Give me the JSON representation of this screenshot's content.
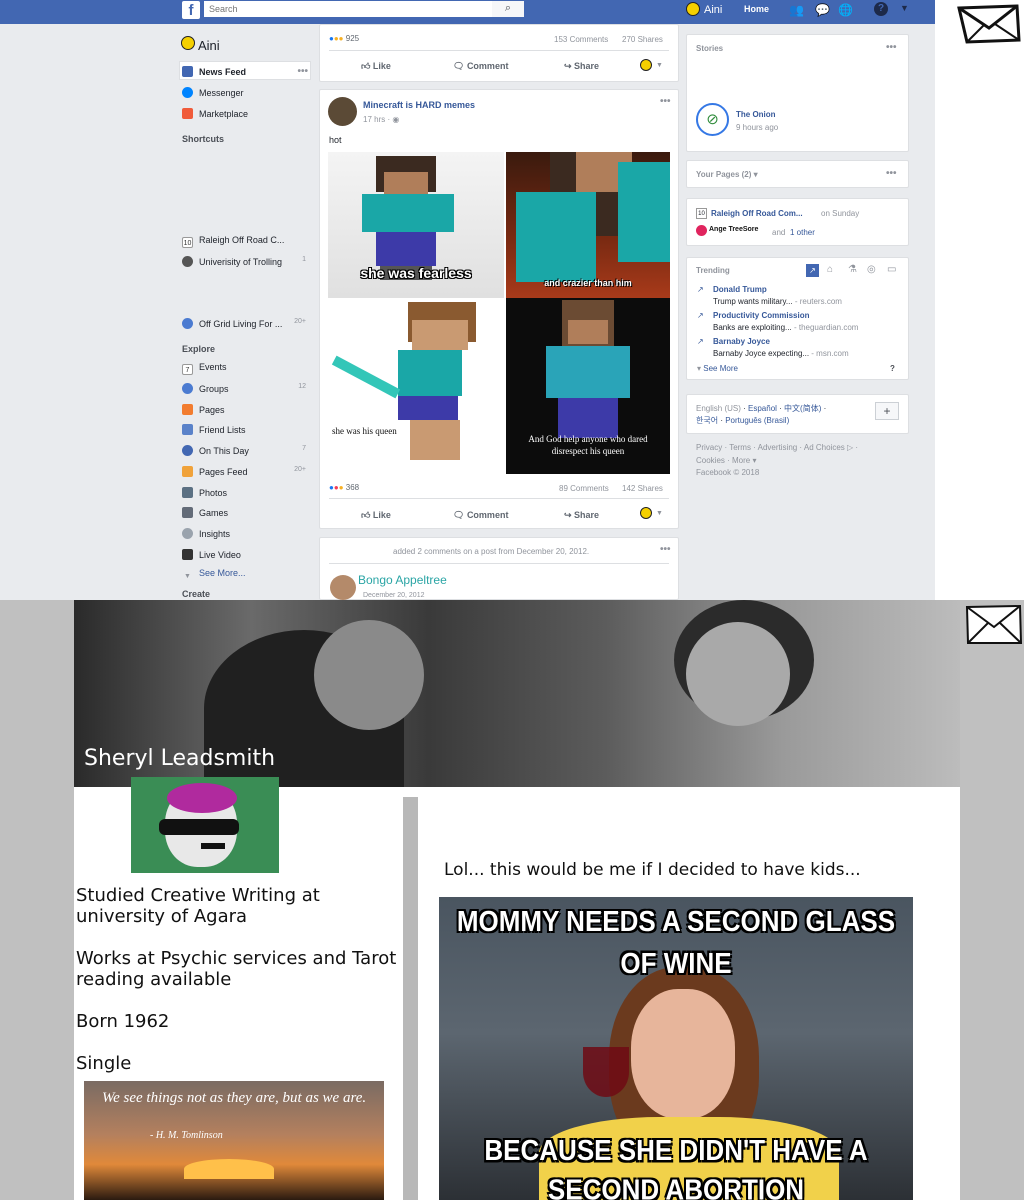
{
  "topbar": {
    "search_placeholder": "Search",
    "user": "Aini",
    "home": "Home"
  },
  "left_nav": {
    "user": "Aini",
    "items": [
      {
        "label": "News Feed",
        "icon": "news-feed-icon"
      },
      {
        "label": "Messenger",
        "icon": "messenger-icon"
      },
      {
        "label": "Marketplace",
        "icon": "marketplace-icon"
      }
    ],
    "shortcuts_heading": "Shortcuts",
    "shortcuts": [
      {
        "label": "Raleigh Off Road C...",
        "count": ""
      },
      {
        "label": "Univerisity of Trolling",
        "count": "1"
      },
      {
        "label": "Off Grid Living For ...",
        "count": "20+"
      }
    ],
    "explore_heading": "Explore",
    "explore": [
      {
        "label": "Events",
        "count": ""
      },
      {
        "label": "Groups",
        "count": "12"
      },
      {
        "label": "Pages",
        "count": ""
      },
      {
        "label": "Friend Lists",
        "count": ""
      },
      {
        "label": "On This Day",
        "count": "7"
      },
      {
        "label": "Pages Feed",
        "count": "20+"
      },
      {
        "label": "Photos",
        "count": ""
      },
      {
        "label": "Games",
        "count": ""
      },
      {
        "label": "Insights",
        "count": ""
      },
      {
        "label": "Live Video",
        "count": ""
      }
    ],
    "see_more": "See More...",
    "create_heading": "Create"
  },
  "post1": {
    "reactions": "925",
    "comments": "153 Comments",
    "shares": "270 Shares",
    "like": "Like",
    "comment": "Comment",
    "share": "Share"
  },
  "post2": {
    "author": "Minecraft is HARD memes",
    "time": "17 hrs",
    "text": "hot",
    "captions": [
      "she was fearless",
      "and crazier than him",
      "she was his queen",
      "And God help anyone who dared disrespect his queen"
    ],
    "reactions": "368",
    "comments": "89 Comments",
    "shares": "142 Shares",
    "like": "Like",
    "comment": "Comment",
    "share": "Share"
  },
  "post3": {
    "activity": "added 2 comments on a post from December 20, 2012.",
    "author": "Bongo Appeltree",
    "date": "December 20, 2012"
  },
  "right": {
    "stories_heading": "Stories",
    "story_name": "The Onion",
    "story_time": "9 hours ago",
    "your_pages": "Your Pages (2)",
    "page_name": "Raleigh Off Road Com...",
    "page_when": "on Sunday",
    "page_person": "Ange TreeSore",
    "page_and": "and",
    "page_other": "1 other",
    "trending_heading": "Trending",
    "trending": [
      {
        "title": "Donald Trump",
        "desc": "Trump wants military...",
        "source": "- reuters.com"
      },
      {
        "title": "Productivity Commission",
        "desc": "Banks are exploiting...",
        "source": "- theguardian.com"
      },
      {
        "title": "Barnaby Joyce",
        "desc": "Barnaby Joyce expecting...",
        "source": "- msn.com"
      }
    ],
    "see_more": "See More",
    "help": "?",
    "lang_current": "English (US)",
    "lang_links": [
      "Español",
      "中文(简体)",
      "한국어",
      "Português (Brasil)"
    ],
    "footer_line1": "Privacy · Terms · Advertising · Ad Choices ▷ ·",
    "footer_line2": "Cookies · More ▾",
    "copyright": "Facebook © 2018"
  },
  "profile": {
    "name": "Sheryl Leadsmith",
    "study": "Studied Creative Writing at university of Agara",
    "work": "Works at Psychic services and Tarot reading available",
    "born": "Born 1962",
    "status": "Single",
    "quote": "We see things not as they are, but as we are.",
    "quote_author": "- H. M. Tomlinson",
    "post_text": "Lol... this would be me if I decided to have kids...",
    "meme_top": "MOMMY NEEDS A SECOND GLASS OF WINE",
    "meme_bottom": "BECAUSE SHE DIDN'T HAVE A SECOND ABORTION"
  },
  "colors": {
    "fb_blue": "#4267b2",
    "link": "#365899",
    "page_bg": "#e9ebee"
  }
}
